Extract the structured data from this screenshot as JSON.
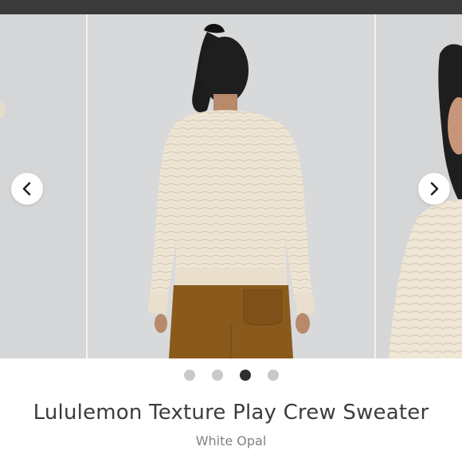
{
  "product": {
    "title": "Lululemon Texture Play Crew Sweater",
    "color_name": "White Opal"
  },
  "carousel": {
    "slide_count": 4,
    "active_index": 2,
    "prev_icon": "chevron-left-icon",
    "next_icon": "chevron-right-icon"
  },
  "colors": {
    "sweater": "#efe6d6",
    "pants": "#8a5a1c",
    "background": "#d7d8d9",
    "dot_active": "#2f2f2f",
    "dot_inactive": "#c9c9c9"
  }
}
